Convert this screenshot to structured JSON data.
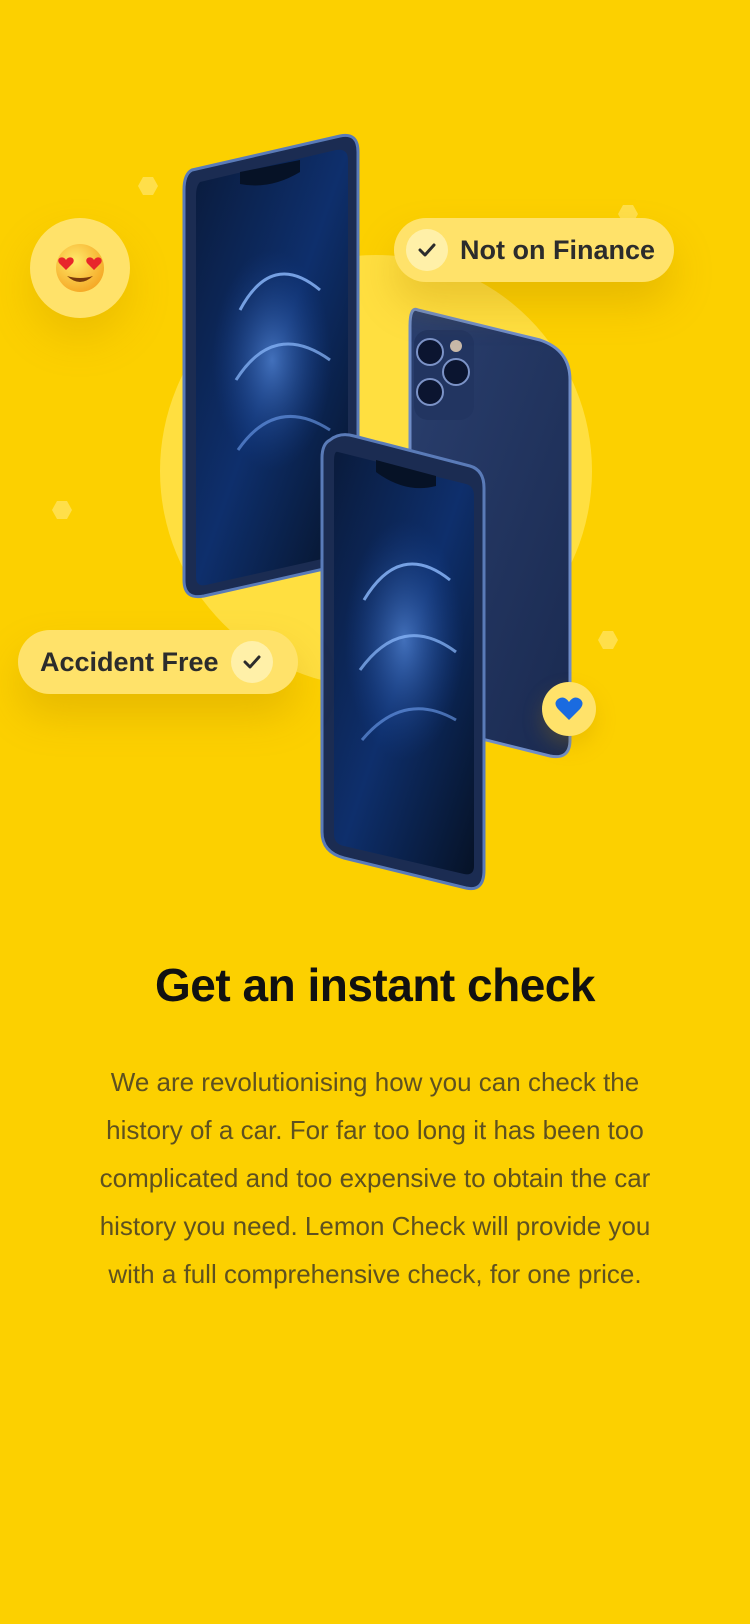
{
  "hero": {
    "badges": {
      "finance": "Not on Finance",
      "accident": "Accident Free"
    },
    "emoji": {
      "face": "😍",
      "heart": "💙"
    },
    "colors": {
      "background": "#FCD000",
      "badge": "#FFE26A",
      "phone": "#1B2C52"
    }
  },
  "content": {
    "title": "Get an instant check",
    "body": "We are revolutionising how you can check the history of a car. For far too long it has been too complicated and too expensive to obtain the car history you need. Lemon Check will provide you with a full comprehensive check, for one price."
  }
}
